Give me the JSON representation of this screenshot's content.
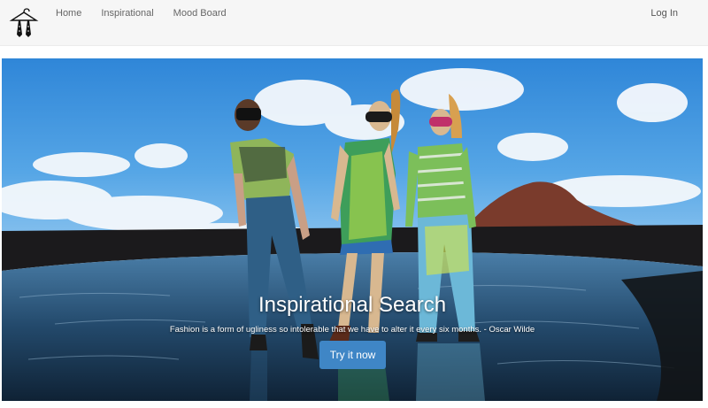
{
  "nav": {
    "brand_icon": "hanger-logo-icon",
    "links": [
      {
        "label": "Home"
      },
      {
        "label": "Inspirational"
      },
      {
        "label": "Mood Board"
      }
    ],
    "login_label": "Log In"
  },
  "hero": {
    "title": "Inspirational Search",
    "quote": "Fashion is a form of ugliness so intolerable that we have to alter it every six months. - Oscar Wilde",
    "cta_label": "Try it now",
    "image_description_icon": "fashion-models-photo",
    "colors": {
      "cta": "#3f86c6",
      "sky": "#3a8fd9",
      "water": "#1f3c57"
    }
  }
}
